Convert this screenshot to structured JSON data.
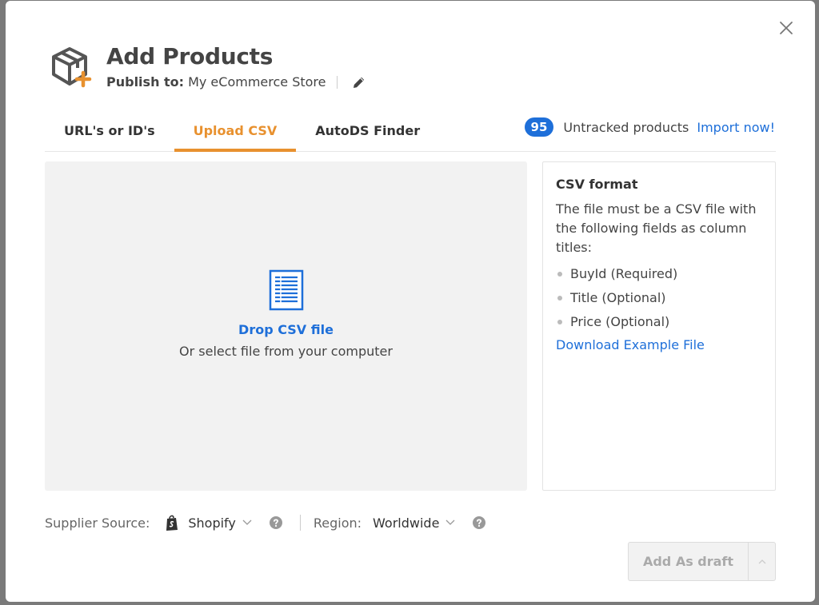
{
  "header": {
    "title": "Add Products",
    "publish_label": "Publish to:",
    "store_name": "My eCommerce Store"
  },
  "tabs": [
    {
      "label": "URL's or ID's",
      "active": false
    },
    {
      "label": "Upload CSV",
      "active": true
    },
    {
      "label": "AutoDS Finder",
      "active": false
    }
  ],
  "untracked": {
    "count": "95",
    "text": "Untracked products",
    "link": "Import now!"
  },
  "dropzone": {
    "title": "Drop CSV file",
    "subtitle": "Or select file from your computer"
  },
  "info": {
    "title": "CSV format",
    "description": "The file must be a CSV file with the following fields as column titles:",
    "fields": [
      "BuyId (Required)",
      "Title (Optional)",
      "Price (Optional)"
    ],
    "download_link": "Download Example File"
  },
  "footer": {
    "supplier_label": "Supplier Source:",
    "supplier_value": "Shopify",
    "region_label": "Region:",
    "region_value": "Worldwide",
    "add_draft_label": "Add As draft"
  },
  "colors": {
    "accent": "#e8912f",
    "link": "#1e6fd9"
  }
}
